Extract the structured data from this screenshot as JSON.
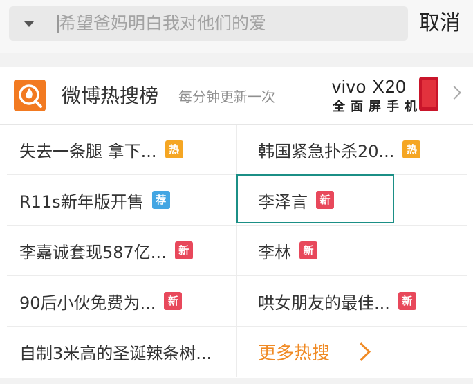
{
  "search": {
    "placeholder": "希望爸妈明白我对他们的爱",
    "cancel_label": "取消",
    "dropdown_icon": "caret-down-icon"
  },
  "hot_search": {
    "title": "微博热搜榜",
    "subtitle": "每分钟更新一次",
    "logo_icon": "weibo-hot-search-icon",
    "ad": {
      "brand": "vivo X20",
      "slogan": "全面屏手机"
    },
    "items": [
      {
        "text": "失去一条腿 拿下...",
        "badge": "热",
        "type": "hot"
      },
      {
        "text": "韩国紧急扑杀20...",
        "badge": "热",
        "type": "hot"
      },
      {
        "text": "R11s新年版开售",
        "badge": "荐",
        "type": "rec"
      },
      {
        "text": "李泽言",
        "badge": "新",
        "type": "new"
      },
      {
        "text": "李嘉诚套现587亿...",
        "badge": "新",
        "type": "new"
      },
      {
        "text": "李林",
        "badge": "新",
        "type": "new"
      },
      {
        "text": "90后小伙免费为...",
        "badge": "新",
        "type": "new"
      },
      {
        "text": "哄女朋友的最佳...",
        "badge": "新",
        "type": "new"
      },
      {
        "text": "自制3米高的圣诞辣条树...",
        "badge": "",
        "type": "none"
      }
    ],
    "more_label": "更多热搜"
  },
  "colors": {
    "accent_orange": "#f08a24",
    "badge_hot": "#f5a623",
    "badge_new": "#e8485b",
    "badge_rec": "#43a6e3",
    "highlight_border": "#1b8f86"
  }
}
